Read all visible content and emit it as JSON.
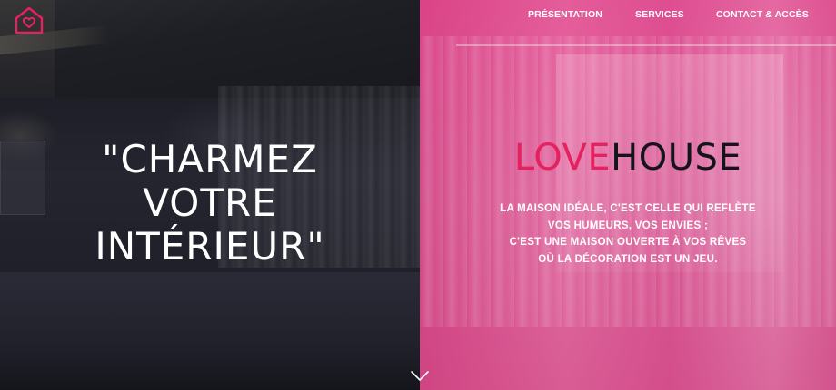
{
  "nav": {
    "items": [
      {
        "label": "PRÉSENTATION"
      },
      {
        "label": "SERVICES"
      },
      {
        "label": "CONTACT & ACCÈS"
      }
    ]
  },
  "hero": {
    "headline_lines": [
      "\"CHARMEZ",
      "VOTRE",
      "INTÉRIEUR\""
    ],
    "brand": {
      "part1": "LOVE",
      "part2": "HOUSE"
    },
    "tagline_lines": [
      "LA MAISON IDÉALE, C'EST CELLE QUI REFLÈTE",
      "VOS HUMEURS, VOS ENVIES ;",
      "C'EST UNE MAISON OUVERTE À VOS RÊVES",
      "OÙ LA DÉCORATION EST UN JEU."
    ]
  },
  "icons": {
    "logo": "house-heart-icon",
    "scroll": "chevron-down-icon"
  },
  "colors": {
    "accent_pink": "#e6215f",
    "brand_dark": "#14141a",
    "panel_pink": "#d9578f",
    "panel_dark": "#1c1d25"
  }
}
